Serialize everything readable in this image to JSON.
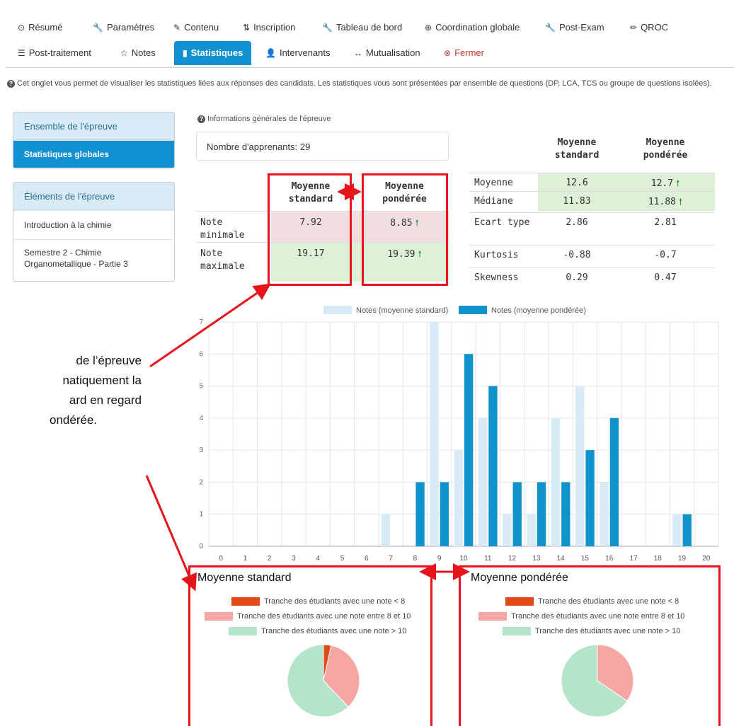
{
  "tabs_row1": [
    {
      "icon": "clock-icon",
      "glyph": "⊙",
      "label": "Résumé",
      "x": 25
    },
    {
      "icon": "wrench-icon",
      "glyph": "🔧",
      "label": "Paramètres",
      "x": 131
    },
    {
      "icon": "edit-icon",
      "glyph": "✎",
      "label": "Contenu",
      "x": 245
    },
    {
      "icon": "sort-icon",
      "glyph": "⇅",
      "label": "Inscription",
      "x": 343
    },
    {
      "icon": "wrench-icon",
      "glyph": "🔧",
      "label": "Tableau de bord",
      "x": 455
    },
    {
      "icon": "globe-icon",
      "glyph": "⊕",
      "label": "Coordination globale",
      "x": 600
    },
    {
      "icon": "wrench-icon",
      "glyph": "🔧",
      "label": "Post-Exam",
      "x": 770
    },
    {
      "icon": "pencil-icon",
      "glyph": "✏",
      "label": "QROC",
      "x": 890
    }
  ],
  "tabs_row2": [
    {
      "icon": "list-icon",
      "glyph": "☰",
      "label": "Post-traitement",
      "x": 25
    },
    {
      "icon": "star-icon",
      "glyph": "☆",
      "label": "Notes",
      "x": 170
    },
    {
      "icon": "bar-chart-icon",
      "glyph": "▮",
      "label": "Statistiques",
      "x": 246,
      "active": true
    },
    {
      "icon": "user-icon",
      "glyph": "👤",
      "label": "Intervenants",
      "x": 375
    },
    {
      "icon": "arrows-icon",
      "glyph": "↔",
      "label": "Mutualisation",
      "x": 500
    },
    {
      "icon": "close-circle-icon",
      "glyph": "⊗",
      "label": "Fermer",
      "x": 627,
      "close": true
    }
  ],
  "info_text": "Cet onglet vous permet de visualiser les statistiques liées aux réponses des candidats. Les statistiques vous sont présentées par ensemble de questions (DP, LCA, TCS ou groupe de questions isolées).",
  "sidebar1": {
    "header": "Ensemble de l'épreuve",
    "items": [
      "Statistiques globales"
    ]
  },
  "sidebar2": {
    "header": "Éléments de l'épreuve",
    "items": [
      "Introduction à la chimie",
      "Semestre 2 - Chimie Organometallique - Partie 3"
    ]
  },
  "general": {
    "section_title": "Informations générales de l'épreuve",
    "count_label": "Nombre d'apprenants: 29",
    "col_std": "Moyenne standard",
    "col_pond": "Moyenne pondérée",
    "min_label": "Note minimale",
    "min_std": "7.92",
    "min_pond": "8.85",
    "max_label": "Note maximale",
    "max_std": "19.17",
    "max_pond": "19.39"
  },
  "stats": {
    "col_std": "Moyenne standard",
    "col_pond": "Moyenne pondérée",
    "rows": [
      {
        "label": "Moyenne",
        "std": "12.6",
        "pond": "12.7",
        "up": true,
        "green": true
      },
      {
        "label": "Médiane",
        "std": "11.83",
        "pond": "11.88",
        "up": true,
        "green": true
      },
      {
        "label": "Ecart type",
        "std": "2.86",
        "pond": "2.81"
      },
      {
        "label": "Kurtosis",
        "std": "-0.88",
        "pond": "-0.7"
      },
      {
        "label": "Skewness",
        "std": "0.29",
        "pond": "0.47"
      }
    ]
  },
  "colors": {
    "std": "#d7eaf6",
    "pond": "#0f93cd",
    "red_frame": "#e8141c",
    "low": "#e34a19",
    "mid": "#f6a7a4",
    "high": "#b5e5c8",
    "green_bg": "#dff0d8",
    "red_bg": "#f2dede"
  },
  "chart_data": {
    "type": "bar",
    "categories": [
      "0",
      "1",
      "2",
      "3",
      "4",
      "5",
      "6",
      "7",
      "8",
      "9",
      "10",
      "11",
      "12",
      "13",
      "14",
      "15",
      "16",
      "17",
      "18",
      "19",
      "20"
    ],
    "series": [
      {
        "name": "Notes (moyenne standard)",
        "values": [
          0,
          0,
          0,
          0,
          0,
          0,
          0,
          1,
          0,
          7,
          3,
          4,
          1,
          1,
          4,
          5,
          2,
          0,
          0,
          1,
          0
        ]
      },
      {
        "name": "Notes (moyenne pondérée)",
        "values": [
          0,
          0,
          0,
          0,
          0,
          0,
          0,
          0,
          2,
          2,
          6,
          5,
          2,
          2,
          2,
          3,
          4,
          0,
          0,
          1,
          0
        ]
      }
    ],
    "ylim": [
      0,
      7
    ],
    "yticks": [
      "0",
      "1",
      "2",
      "3",
      "4",
      "5",
      "6",
      "7"
    ],
    "legend": "top"
  },
  "pies": [
    {
      "title": "Moyenne standard",
      "legend": [
        "Tranche des étudiants avec une note < 8",
        "Tranche des étudiants avec une note entre 8 et 10",
        "Tranche des étudiants avec une note > 10"
      ],
      "values": [
        1,
        10,
        18
      ]
    },
    {
      "title": "Moyenne pondérée",
      "legend": [
        "Tranche des étudiants avec une note < 8",
        "Tranche des étudiants avec une note entre 8 et 10",
        "Tranche des étudiants avec une note > 10"
      ],
      "values": [
        0,
        10,
        19
      ]
    }
  ],
  "overlay_lines": [
    "de l’épreuve",
    "natiquement la",
    "ard en regard",
    "ondérée."
  ]
}
